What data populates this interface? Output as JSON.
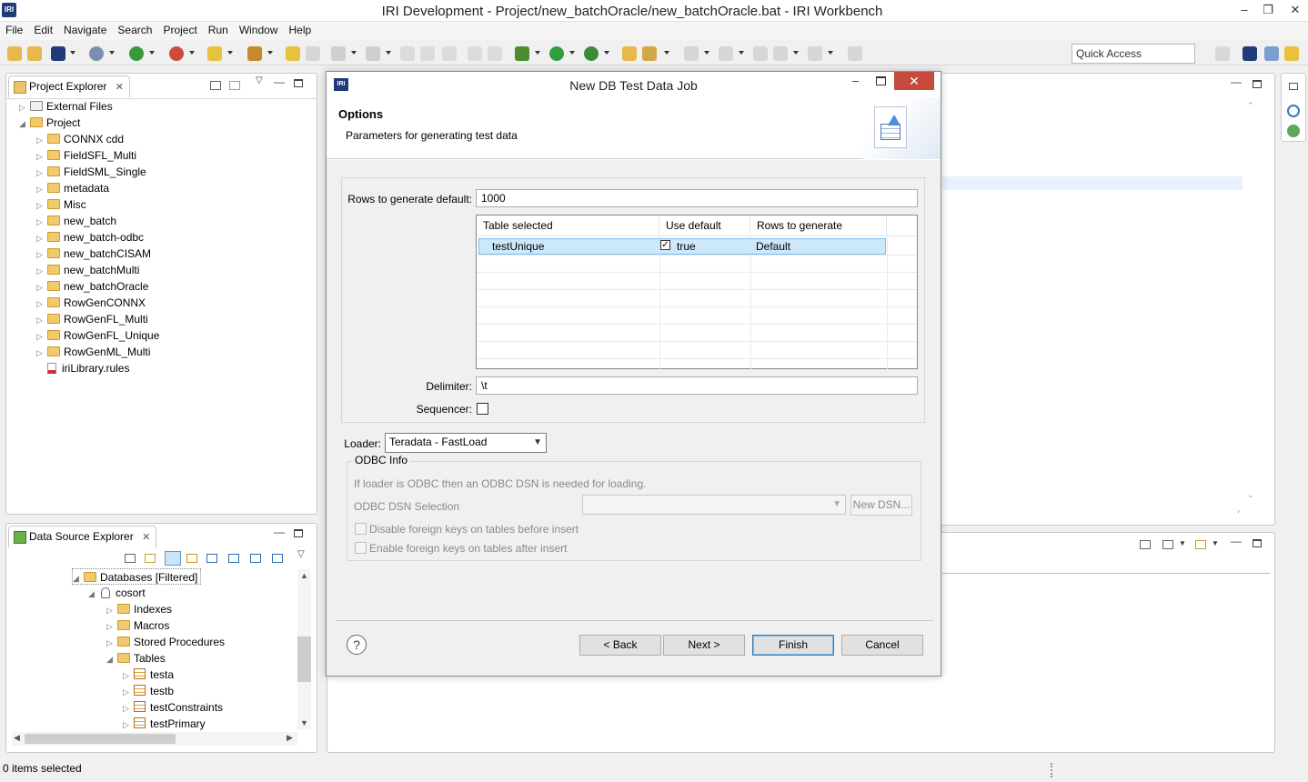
{
  "window": {
    "title": "IRI Development - Project/new_batchOracle/new_batchOracle.bat - IRI Workbench",
    "app_icon_text": "IRI"
  },
  "menu": [
    "File",
    "Edit",
    "Navigate",
    "Search",
    "Project",
    "Run",
    "Window",
    "Help"
  ],
  "quick_access": {
    "placeholder": "Quick Access"
  },
  "project_explorer": {
    "tab_label": "Project Explorer",
    "tree": [
      {
        "label": "External Files",
        "level": 0,
        "expanded": false
      },
      {
        "label": "Project",
        "level": 0,
        "expanded": true
      },
      {
        "label": "CONNX cdd",
        "level": 1
      },
      {
        "label": "FieldSFL_Multi",
        "level": 1
      },
      {
        "label": "FieldSML_Single",
        "level": 1
      },
      {
        "label": "metadata",
        "level": 1
      },
      {
        "label": "Misc",
        "level": 1
      },
      {
        "label": "new_batch",
        "level": 1
      },
      {
        "label": "new_batch-odbc",
        "level": 1
      },
      {
        "label": "new_batchCISAM",
        "level": 1
      },
      {
        "label": "new_batchMulti",
        "level": 1
      },
      {
        "label": "new_batchOracle",
        "level": 1
      },
      {
        "label": "RowGenCONNX",
        "level": 1
      },
      {
        "label": "RowGenFL_Multi",
        "level": 1
      },
      {
        "label": "RowGenFL_Unique",
        "level": 1
      },
      {
        "label": "RowGenML_Multi",
        "level": 1
      },
      {
        "label": "iriLibrary.rules",
        "level": 1,
        "file": true
      }
    ]
  },
  "data_source_explorer": {
    "tab_label": "Data Source Explorer",
    "tree": [
      {
        "label": "Databases [Filtered]",
        "level": 0
      },
      {
        "label": "cosort",
        "level": 1
      },
      {
        "label": "Indexes",
        "level": 2
      },
      {
        "label": "Macros",
        "level": 2
      },
      {
        "label": "Stored Procedures",
        "level": 2
      },
      {
        "label": "Tables",
        "level": 2
      },
      {
        "label": "testa",
        "level": 3
      },
      {
        "label": "testb",
        "level": 3
      },
      {
        "label": "testConstraints",
        "level": 3
      },
      {
        "label": "testPrimary",
        "level": 3
      }
    ]
  },
  "dialog": {
    "title": "New DB Test Data Job",
    "header_title": "Options",
    "header_desc": "Parameters for generating test data",
    "rows_label": "Rows to generate default:",
    "rows_value": "1000",
    "grid": {
      "columns": [
        "Table selected",
        "Use default",
        "Rows to generate"
      ],
      "rows": [
        {
          "table": "testUnique",
          "use_default": "true",
          "rows": "Default"
        }
      ]
    },
    "delimiter_label": "Delimiter:",
    "delimiter_value": "\\t",
    "sequencer_label": "Sequencer:",
    "loader_label": "Loader:",
    "loader_value": "Teradata - FastLoad",
    "odbc_group": "ODBC Info",
    "odbc_note": "If loader is ODBC then an ODBC DSN is needed for loading.",
    "odbc_dsn_label": "ODBC DSN Selection",
    "new_dsn_button": "New DSN...",
    "disable_fk_label": "Disable foreign keys on tables before insert",
    "enable_fk_label": "Enable foreign keys on tables after insert",
    "buttons": {
      "back": "< Back",
      "next": "Next >",
      "finish": "Finish",
      "cancel": "Cancel"
    }
  },
  "status": {
    "text": "0 items selected"
  }
}
